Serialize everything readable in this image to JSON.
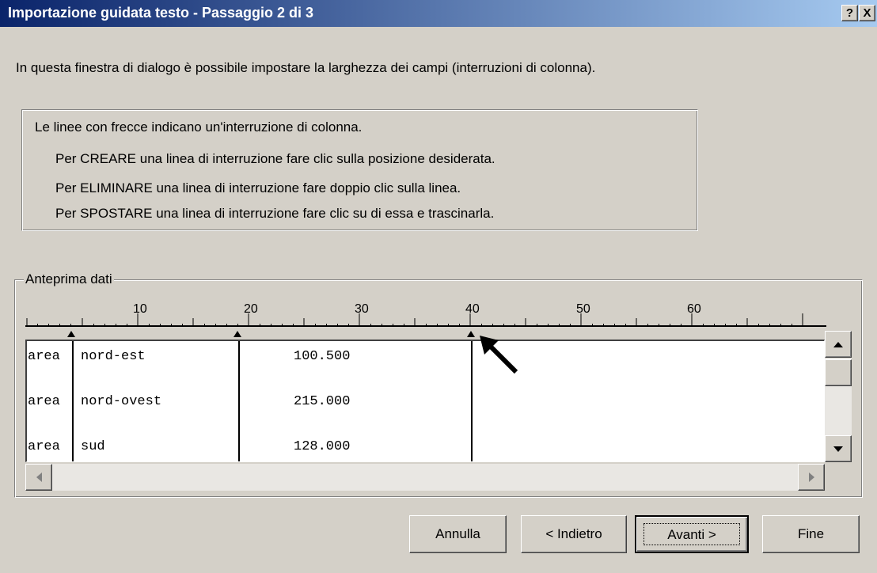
{
  "window": {
    "title": "Importazione guidata testo - Passaggio 2 di 3",
    "help_label": "?",
    "close_label": "X"
  },
  "intro_text": "In questa finestra di dialogo è possibile impostare la larghezza dei campi (interruzioni di colonna).",
  "info": {
    "heading": "Le linee con frecce indicano un'interruzione di colonna.",
    "lines": [
      "Per CREARE una linea di interruzione fare clic sulla posizione desiderata.",
      "Per ELIMINARE una linea di interruzione fare doppio clic sulla linea.",
      "Per SPOSTARE una linea di interruzione fare clic su di essa e trascinarla."
    ]
  },
  "preview": {
    "group_label": "Anteprima dati",
    "ruler_labels": [
      "10",
      "20",
      "30",
      "40",
      "50",
      "60"
    ],
    "rows": [
      [
        "area",
        "nord-est",
        "100.500"
      ],
      [
        "area",
        "nord-ovest",
        "215.000"
      ],
      [
        "area",
        "sud",
        "128.000"
      ]
    ]
  },
  "buttons": {
    "cancel": "Annulla",
    "back": "< Indietro",
    "next": "Avanti >",
    "finish": "Fine"
  }
}
